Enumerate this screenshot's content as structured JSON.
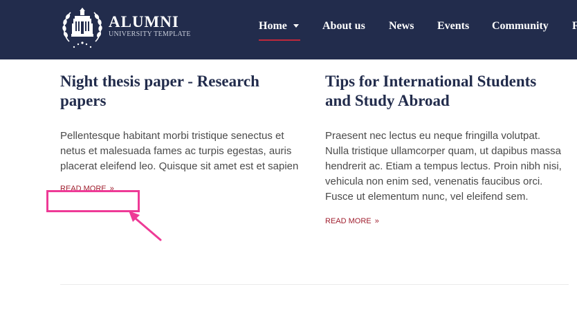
{
  "brand": {
    "title": "ALUMNI",
    "subtitle": "UNIVERSITY TEMPLATE"
  },
  "nav": {
    "items": [
      {
        "label": "Home",
        "has_dropdown": true,
        "active": true
      },
      {
        "label": "About us"
      },
      {
        "label": "News"
      },
      {
        "label": "Events"
      },
      {
        "label": "Community"
      },
      {
        "label": "F"
      }
    ]
  },
  "articles": [
    {
      "title": "Night thesis paper - Research papers",
      "excerpt": "Pellentesque habitant morbi tristique senectus et netus et malesuada fames ac turpis egestas, auris placerat eleifend leo. Quisque sit amet est et sapien",
      "read_more": "READ MORE",
      "chevron": "»"
    },
    {
      "title": "Tips for International Students and Study Abroad",
      "excerpt": "Praesent nec lectus eu neque fringilla volutpat. Nulla tristique ullamcorper quam, ut dapibus massa hendrerit ac. Etiam a tempus lectus. Proin nibh nisi, vehicula non enim sed, venenatis faucibus orci. Fusce ut elementum nunc, vel eleifend sem.",
      "read_more": "READ MORE",
      "chevron": "»"
    }
  ],
  "colors": {
    "header_bg": "#222c4c",
    "accent": "#c0283b",
    "link": "#a01f2f",
    "annotation": "#ee3a96"
  },
  "icons": {
    "logo": "university-building-laurel-emblem",
    "dropdown": "caret-down-icon",
    "read_more": "double-chevron-right"
  }
}
